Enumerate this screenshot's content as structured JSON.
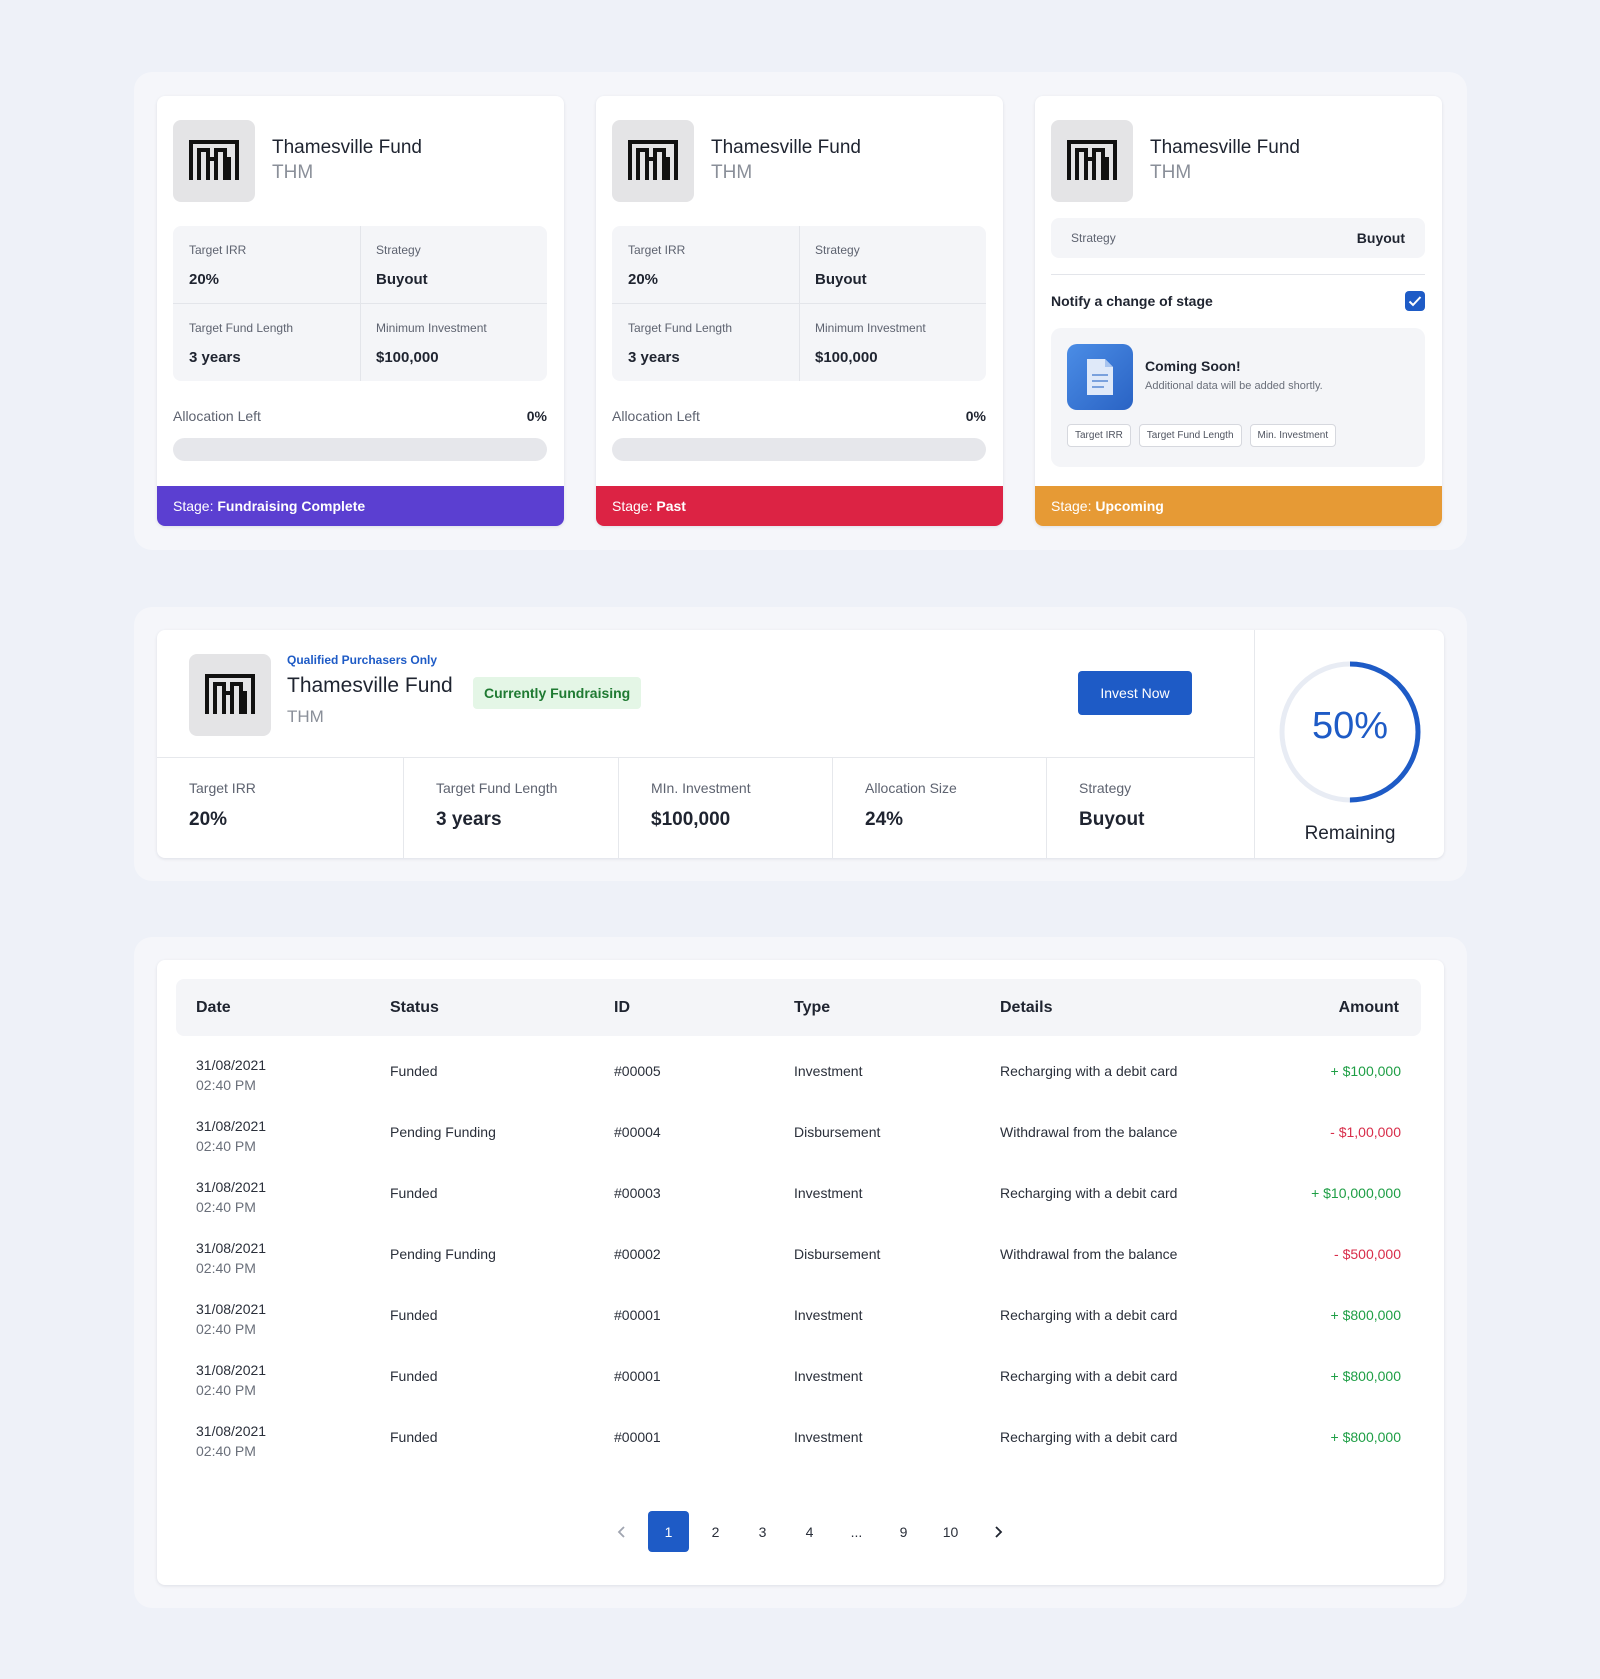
{
  "fund": {
    "name": "Thamesville Fund",
    "ticker": "THM"
  },
  "cards": [
    {
      "metrics": [
        {
          "label": "Target IRR",
          "value": "20%"
        },
        {
          "label": "Strategy",
          "value": "Buyout"
        },
        {
          "label": "Target Fund Length",
          "value": "3 years"
        },
        {
          "label": "Minimum Investment",
          "value": "$100,000"
        }
      ],
      "allocation_label": "Allocation Left",
      "allocation_pct": "0%",
      "allocation_fraction": 0,
      "stage_prefix": "Stage:",
      "stage": "Fundraising Complete",
      "stage_color": "#5b3fd1"
    },
    {
      "metrics": [
        {
          "label": "Target IRR",
          "value": "20%"
        },
        {
          "label": "Strategy",
          "value": "Buyout"
        },
        {
          "label": "Target Fund Length",
          "value": "3 years"
        },
        {
          "label": "Minimum Investment",
          "value": "$100,000"
        }
      ],
      "allocation_label": "Allocation Left",
      "allocation_pct": "0%",
      "allocation_fraction": 0,
      "stage_prefix": "Stage:",
      "stage": "Past",
      "stage_color": "#dc2344"
    },
    {
      "strategy_label": "Strategy",
      "strategy_value": "Buyout",
      "notify_label": "Notify a change of stage",
      "notify_checked": true,
      "coming_title": "Coming Soon!",
      "coming_sub": "Additional data will be added shortly.",
      "chips": [
        "Target IRR",
        "Target Fund Length",
        "Min. Investment"
      ],
      "stage_prefix": "Stage:",
      "stage": "Upcoming",
      "stage_color": "#e69a35"
    }
  ],
  "wide": {
    "qualifier": "Qualified Purchasers Only",
    "status": "Currently Fundraising",
    "invest_label": "Invest Now",
    "metrics": [
      {
        "label": "Target IRR",
        "value": "20%"
      },
      {
        "label": "Target Fund Length",
        "value": "3 years"
      },
      {
        "label": "MIn. Investment",
        "value": "$100,000"
      },
      {
        "label": "Allocation Size",
        "value": "24%"
      },
      {
        "label": "Strategy",
        "value": "Buyout"
      }
    ],
    "remaining_pct": "50%",
    "remaining_fraction": 0.5,
    "remaining_label": "Remaining",
    "accent": "#1e5bc6"
  },
  "table": {
    "headers": {
      "date": "Date",
      "status": "Status",
      "id": "ID",
      "type": "Type",
      "details": "Details",
      "amount": "Amount"
    },
    "rows": [
      {
        "date": "31/08/2021",
        "time": "02:40 PM",
        "status": "Funded",
        "id": "#00005",
        "type": "Investment",
        "details": "Recharging with a debit card",
        "amount": "+ $100,000",
        "sign": "pos"
      },
      {
        "date": "31/08/2021",
        "time": "02:40 PM",
        "status": "Pending Funding",
        "id": "#00004",
        "type": "Disbursement",
        "details": "Withdrawal from the balance",
        "amount": "- $1,00,000",
        "sign": "neg"
      },
      {
        "date": "31/08/2021",
        "time": "02:40 PM",
        "status": "Funded",
        "id": "#00003",
        "type": "Investment",
        "details": "Recharging with a debit card",
        "amount": "+ $10,000,000",
        "sign": "pos"
      },
      {
        "date": "31/08/2021",
        "time": "02:40 PM",
        "status": "Pending Funding",
        "id": "#00002",
        "type": "Disbursement",
        "details": "Withdrawal from the balance",
        "amount": "- $500,000",
        "sign": "neg"
      },
      {
        "date": "31/08/2021",
        "time": "02:40 PM",
        "status": "Funded",
        "id": "#00001",
        "type": "Investment",
        "details": "Recharging with a debit card",
        "amount": "+ $800,000",
        "sign": "pos"
      },
      {
        "date": "31/08/2021",
        "time": "02:40 PM",
        "status": "Funded",
        "id": "#00001",
        "type": "Investment",
        "details": "Recharging with a debit card",
        "amount": "+ $800,000",
        "sign": "pos"
      },
      {
        "date": "31/08/2021",
        "time": "02:40 PM",
        "status": "Funded",
        "id": "#00001",
        "type": "Investment",
        "details": "Recharging with a debit card",
        "amount": "+ $800,000",
        "sign": "pos"
      }
    ],
    "colors": {
      "pos": "#1e9e45",
      "neg": "#d82d4a"
    }
  },
  "pagination": {
    "pages": [
      "1",
      "2",
      "3",
      "4",
      "...",
      "9",
      "10"
    ],
    "current": "1",
    "prev_icon": "chevron-left-icon",
    "next_icon": "chevron-right-icon"
  }
}
